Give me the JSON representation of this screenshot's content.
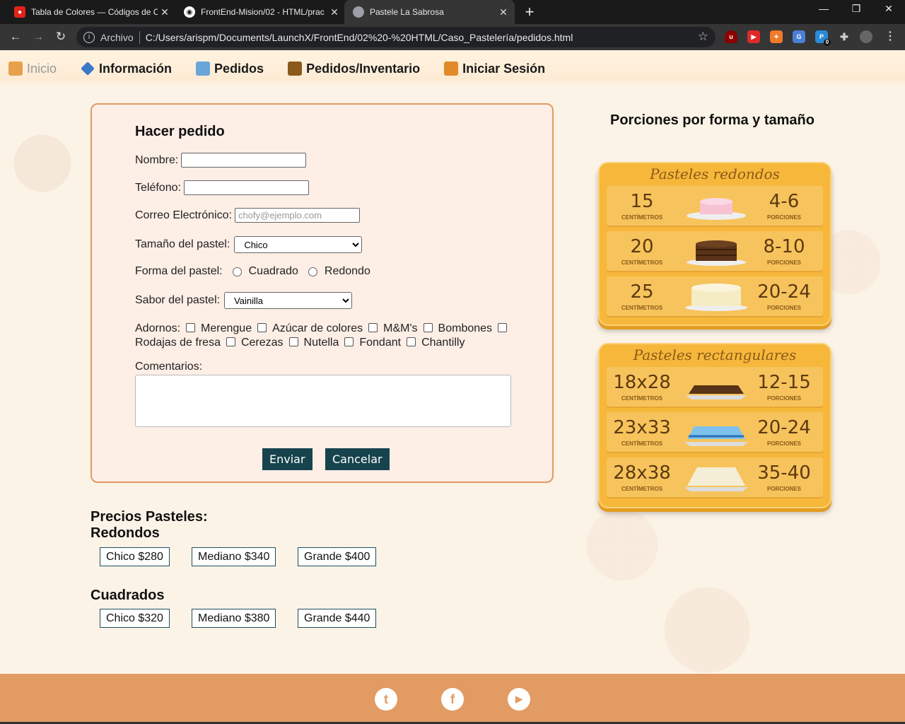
{
  "browser": {
    "tabs": [
      {
        "title": "Tabla de Colores — Códigos de C",
        "favicon_color": "#e2231a",
        "active": false
      },
      {
        "title": "FrontEnd-Mision/02 - HTML/prac",
        "favicon_color": "#ffffff",
        "active": false
      },
      {
        "title": "Pastele La Sabrosa",
        "favicon_color": "#9aa0a6",
        "active": true
      }
    ],
    "address": {
      "scheme": "Archivo",
      "url": "C:/Users/arispm/Documents/LaunchX/FrontEnd/02%20-%20HTML/Caso_Pastelería/pedidos.html"
    },
    "extension_badge": "0"
  },
  "nav": {
    "items": [
      {
        "label": "Inicio",
        "icon": "cake-box-icon",
        "color": "#e6a14a"
      },
      {
        "label": "Información",
        "icon": "info-gem-icon",
        "color": "#3a78c8"
      },
      {
        "label": "Pedidos",
        "icon": "store-icon",
        "color": "#6aa5d8"
      },
      {
        "label": "Pedidos/Inventario",
        "icon": "inventory-icon",
        "color": "#8a5a1a"
      },
      {
        "label": "Iniciar Sesión",
        "icon": "login-door-icon",
        "color": "#e08a2a"
      }
    ]
  },
  "form": {
    "title": "Hacer pedido",
    "nombre_label": "Nombre:",
    "telefono_label": "Teléfono:",
    "correo_label": "Correo Electrónico:",
    "correo_placeholder": "chofy@ejemplo.com",
    "tamano_label": "Tamaño del pastel:",
    "tamano_value": "Chico",
    "forma_label": "Forma del pastel:",
    "forma_options": [
      "Cuadrado",
      "Redondo"
    ],
    "sabor_label": "Sabor del pastel:",
    "sabor_value": "Vainilla",
    "adornos_label": "Adornos:",
    "adornos": [
      "Merengue",
      "Azúcar de colores",
      "M&M's",
      "Bombones",
      "Rodajas de fresa",
      "Cerezas",
      "Nutella",
      "Fondant",
      "Chantilly"
    ],
    "comentarios_label": "Comentarios:",
    "enviar": "Enviar",
    "cancelar": "Cancelar"
  },
  "precios": {
    "title": "Precios Pasteles:",
    "redondos_title": "Redondos",
    "redondos": [
      "Chico $280",
      "Mediano $340",
      "Grande $400"
    ],
    "cuadrados_title": "Cuadrados",
    "cuadrados": [
      "Chico $320",
      "Mediano $380",
      "Grande $440"
    ]
  },
  "porciones": {
    "title": "Porciones por forma y tamaño",
    "redondos_title": "Pasteles redondos",
    "redondos": [
      {
        "size": "15",
        "unit": "CENTÍMETROS",
        "portions": "4-6",
        "portions_unit": "PORCIONES",
        "cake_color": "#f7c3d3"
      },
      {
        "size": "20",
        "unit": "CENTÍMETROS",
        "portions": "8-10",
        "portions_unit": "PORCIONES",
        "cake_color": "#5a3418"
      },
      {
        "size": "25",
        "unit": "CENTÍMETROS",
        "portions": "20-24",
        "portions_unit": "PORCIONES",
        "cake_color": "#f6ecc4"
      }
    ],
    "rect_title": "Pasteles rectangulares",
    "rectangulares": [
      {
        "size": "18x28",
        "unit": "CENTÍMETROS",
        "portions": "12-15",
        "portions_unit": "PORCIONES",
        "cake_color": "#5a3418"
      },
      {
        "size": "23x33",
        "unit": "CENTÍMETROS",
        "portions": "20-24",
        "portions_unit": "PORCIONES",
        "cake_color": "#7ec1ec"
      },
      {
        "size": "28x38",
        "unit": "CENTÍMETROS",
        "portions": "35-40",
        "portions_unit": "PORCIONES",
        "cake_color": "#f4eed6"
      }
    ]
  },
  "footer": {
    "social": [
      {
        "icon": "twitter-icon",
        "glyph": "t"
      },
      {
        "icon": "facebook-icon",
        "glyph": "f"
      },
      {
        "icon": "youtube-icon",
        "glyph": "▶"
      }
    ]
  }
}
